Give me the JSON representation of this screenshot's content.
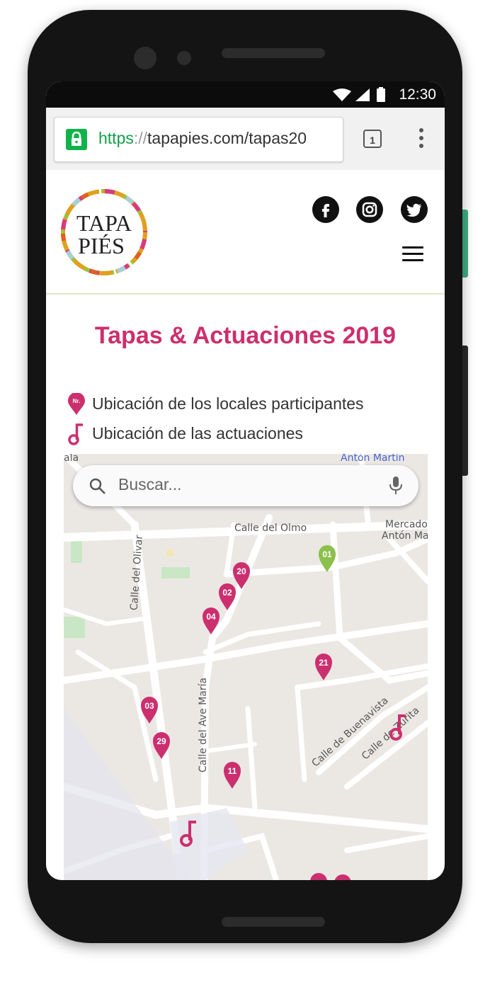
{
  "status_bar": {
    "time": "12:30"
  },
  "browser": {
    "url_scheme": "https",
    "url_separator": "://",
    "url_rest": "tapapies.com/tapas20",
    "tab_count": "1"
  },
  "header": {
    "logo_line1": "TAPA",
    "logo_line2": "PIÉS",
    "social": [
      "facebook-icon",
      "instagram-icon",
      "twitter-icon"
    ]
  },
  "page": {
    "title": "Tapas & Actuaciones 2019",
    "legend": [
      {
        "icon_text": "Nr.",
        "label": "Ubicación de los locales participantes"
      },
      {
        "label": "Ubicación de las actuaciones"
      }
    ]
  },
  "map": {
    "search_placeholder": "Buscar...",
    "streets": {
      "anton_martin": "Antón Martín",
      "calle_olmo": "Calle del Olmo",
      "mercado_1": "Mercado",
      "mercado_2": "Antón Mar",
      "calle_olivar": "Calle del Olivar",
      "calle_ave_maria": "Calle del Ave María",
      "calle_buenavista": "Calle de Buenavista",
      "calle_zurita": "Calle de Zurita",
      "edge_left": "ala"
    },
    "pins": [
      {
        "id": "01",
        "color": "#8cbf4b"
      },
      {
        "id": "20",
        "color": "#cc2f6e"
      },
      {
        "id": "02",
        "color": "#cc2f6e"
      },
      {
        "id": "04",
        "color": "#cc2f6e"
      },
      {
        "id": "21",
        "color": "#cc2f6e"
      },
      {
        "id": "03",
        "color": "#cc2f6e"
      },
      {
        "id": "29",
        "color": "#cc2f6e"
      },
      {
        "id": "11",
        "color": "#cc2f6e"
      }
    ]
  },
  "colors": {
    "accent": "#cc2f6e",
    "green_pin": "#8cbf4b",
    "lock": "#10b34a"
  }
}
